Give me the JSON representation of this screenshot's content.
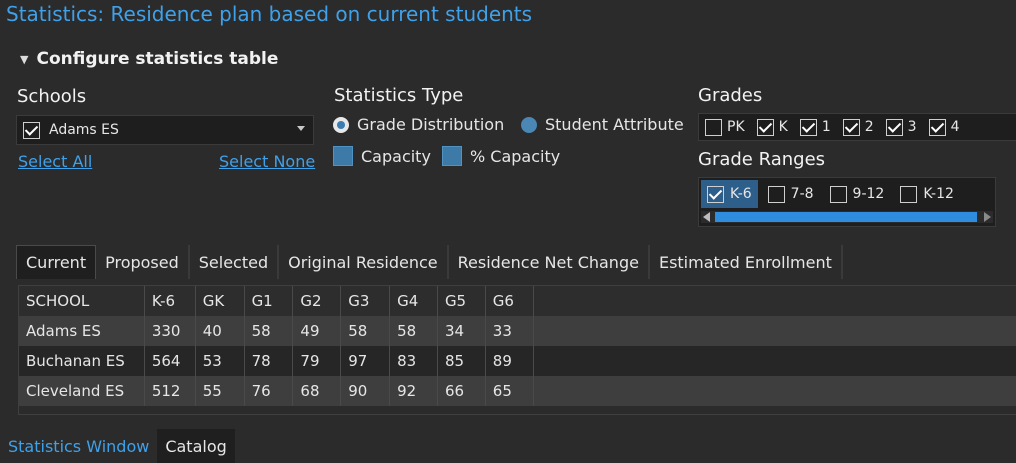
{
  "window": {
    "title": "Statistics: Residence plan based on current students"
  },
  "config": {
    "header": "Configure statistics table",
    "schools": {
      "label": "Schools",
      "selected": "Adams ES",
      "select_all": "Select All",
      "select_none": "Select None"
    },
    "stats_type": {
      "label": "Statistics Type",
      "options": [
        "Grade Distribution",
        "Student Attribute"
      ],
      "selected": "Grade Distribution",
      "checks": [
        "Capacity",
        "% Capacity"
      ]
    },
    "grades": {
      "label": "Grades",
      "items": [
        {
          "label": "PK",
          "checked": false
        },
        {
          "label": "K",
          "checked": true
        },
        {
          "label": "1",
          "checked": true
        },
        {
          "label": "2",
          "checked": true
        },
        {
          "label": "3",
          "checked": true
        },
        {
          "label": "4",
          "checked": true
        }
      ]
    },
    "grade_ranges": {
      "label": "Grade Ranges",
      "items": [
        {
          "label": "K-6",
          "checked": true
        },
        {
          "label": "7-8",
          "checked": false
        },
        {
          "label": "9-12",
          "checked": false
        },
        {
          "label": "K-12",
          "checked": false
        }
      ]
    }
  },
  "tabs": [
    "Current",
    "Proposed",
    "Selected",
    "Original Residence",
    "Residence Net Change",
    "Estimated Enrollment"
  ],
  "active_tab": "Current",
  "table": {
    "columns": [
      "SCHOOL",
      "K-6",
      "GK",
      "G1",
      "G2",
      "G3",
      "G4",
      "G5",
      "G6"
    ],
    "rows": [
      [
        "Adams ES",
        "330",
        "40",
        "58",
        "49",
        "58",
        "58",
        "34",
        "33"
      ],
      [
        "Buchanan ES",
        "564",
        "53",
        "78",
        "79",
        "97",
        "83",
        "85",
        "89"
      ],
      [
        "Cleveland ES",
        "512",
        "55",
        "76",
        "68",
        "90",
        "92",
        "66",
        "65"
      ]
    ]
  },
  "bottom_tabs": [
    "Statistics Window",
    "Catalog"
  ],
  "colors": {
    "accent": "#3fa1ea",
    "background": "#2b2b2b",
    "selection": "#2d5f8a"
  }
}
